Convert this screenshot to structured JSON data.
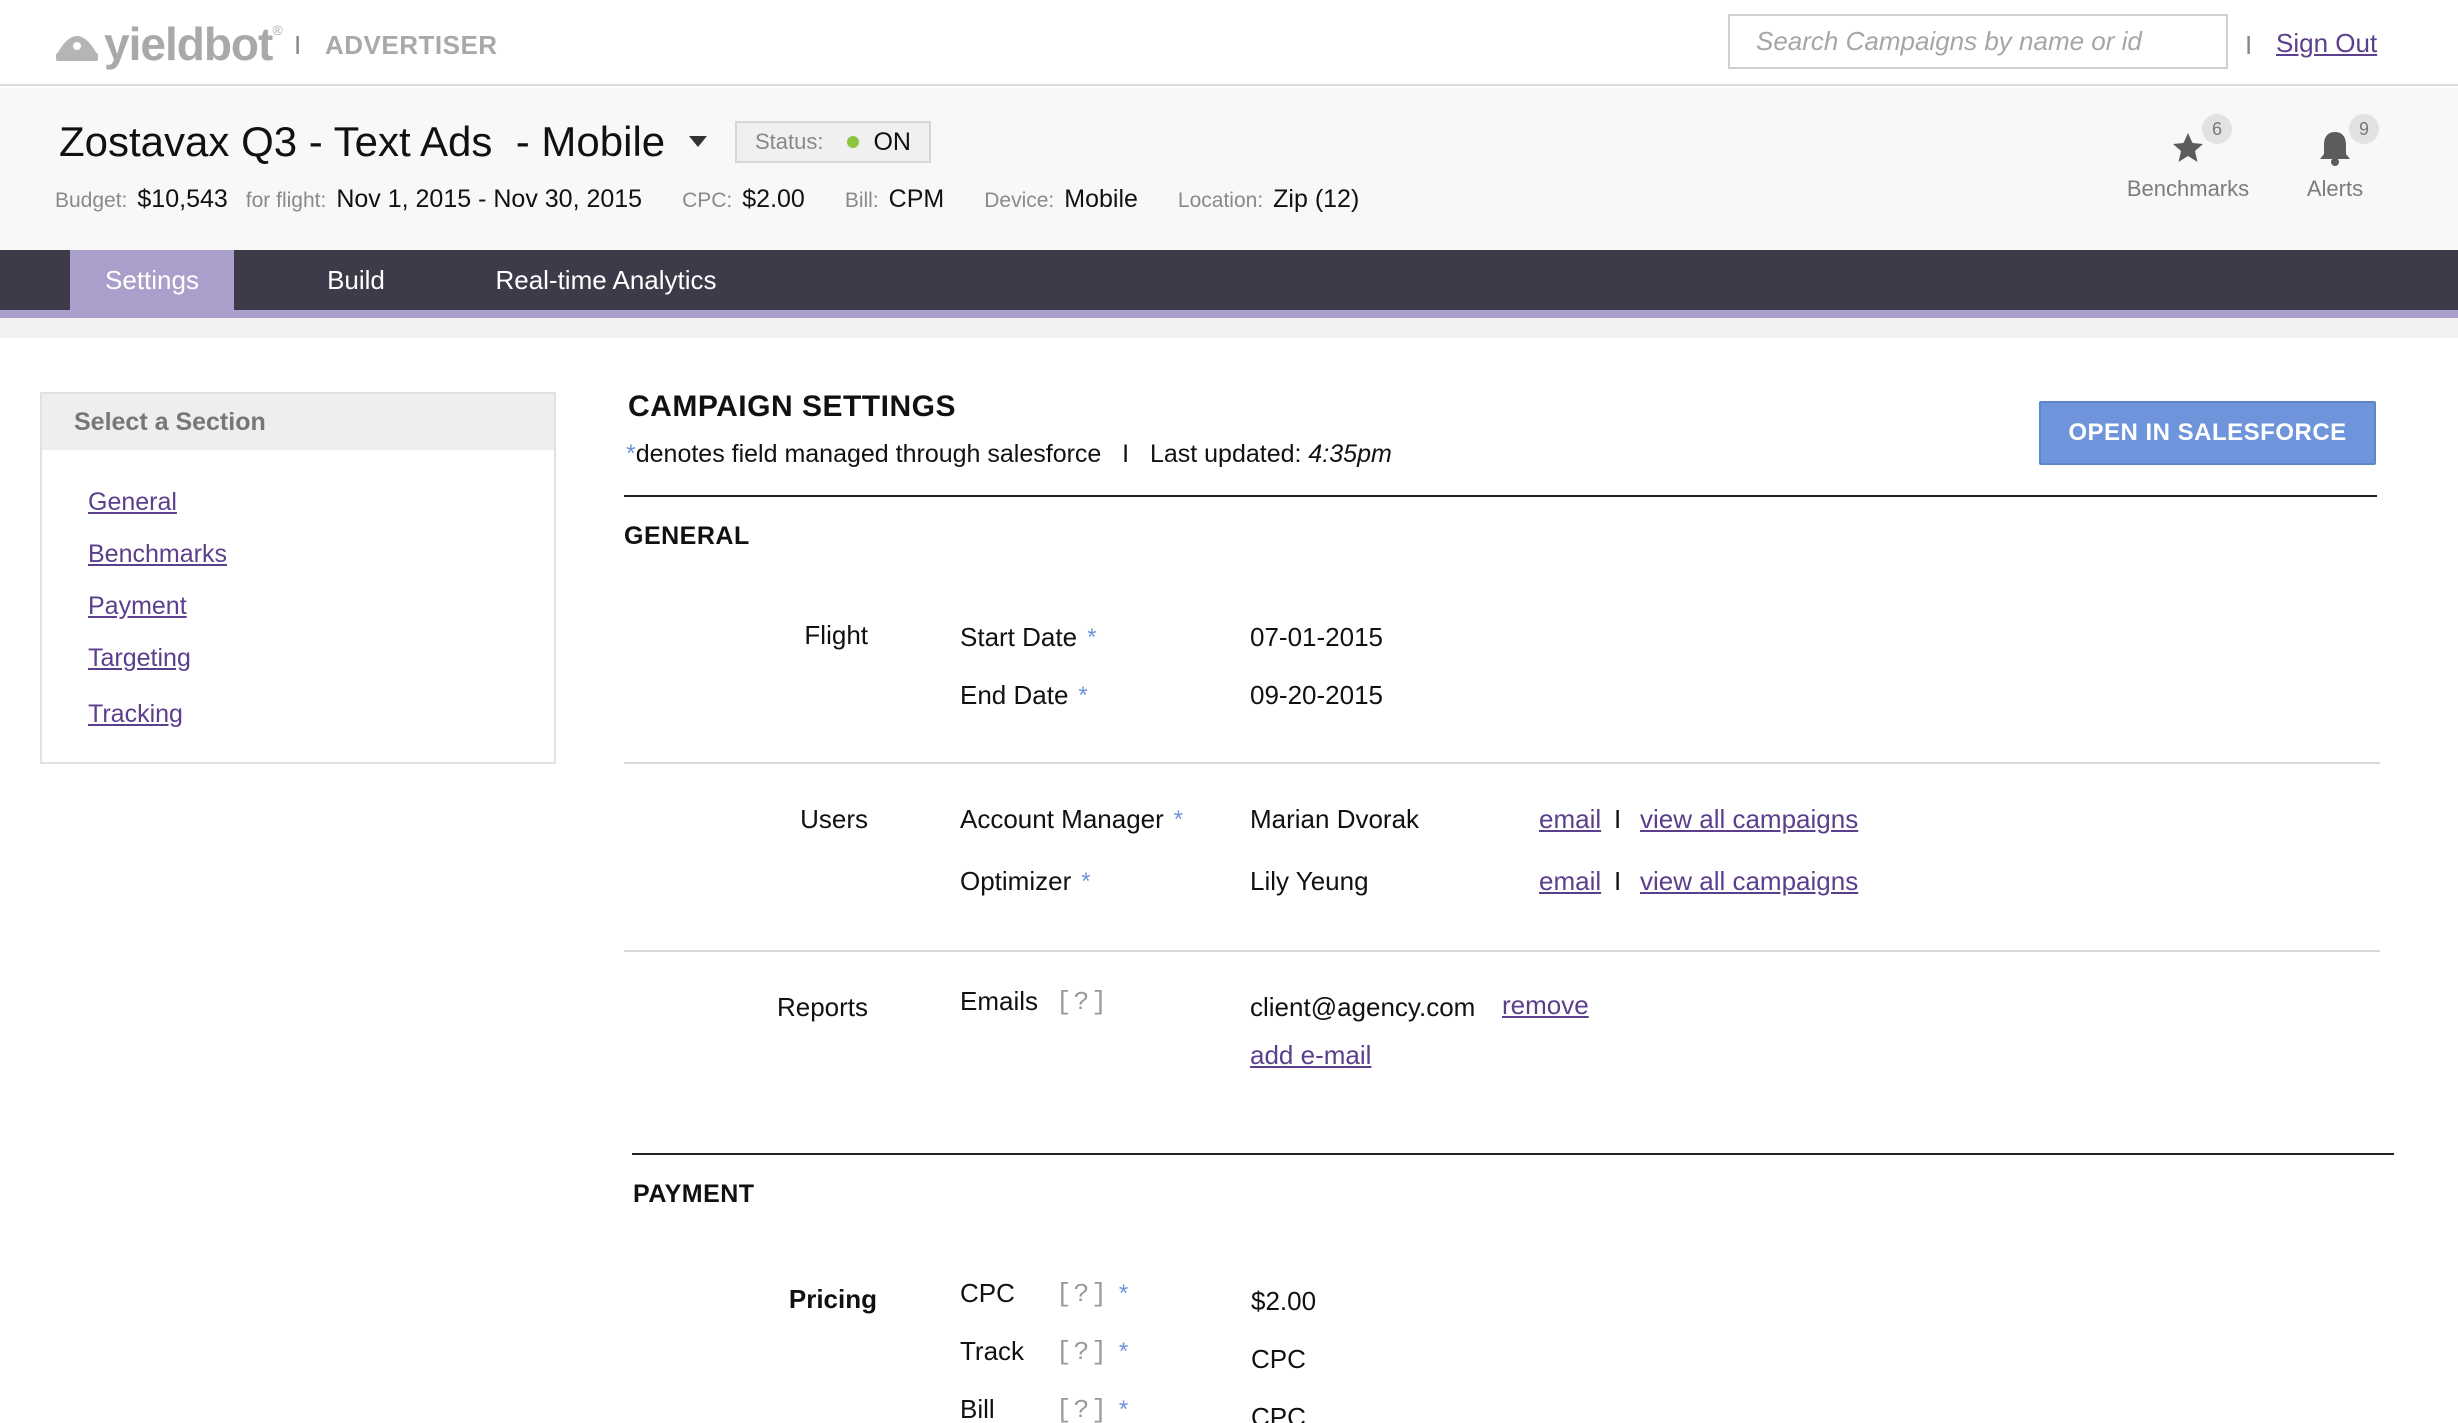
{
  "brand": {
    "logo_text": "yieldbot",
    "trademark": "®",
    "section": "ADVERTISER"
  },
  "top": {
    "search_placeholder": "Search Campaigns by name or id",
    "separator": "I",
    "signout": "Sign Out"
  },
  "campaign": {
    "title": "Zostavax Q3 - Text Ads  - Mobile",
    "status_label": "Status:",
    "status_value": "ON",
    "status_color": "#8cc63f",
    "meta": {
      "budget_label": "Budget:",
      "budget": "$10,543",
      "flight_label": "for flight:",
      "flight": "Nov 1, 2015 - Nov 30, 2015",
      "cpc_label": "CPC:",
      "cpc": "$2.00",
      "bill_label": "Bill:",
      "bill": "CPM",
      "device_label": "Device:",
      "device": "Mobile",
      "location_label": "Location:",
      "location": "Zip (12)"
    },
    "benchmarks": {
      "label": "Benchmarks",
      "count": "6",
      "icon": "star-icon"
    },
    "alerts": {
      "label": "Alerts",
      "count": "9",
      "icon": "bell-icon"
    }
  },
  "nav": {
    "tabs": [
      {
        "label": "Settings",
        "active": true
      },
      {
        "label": "Build"
      },
      {
        "label": "Real-time Analytics"
      }
    ]
  },
  "sidebar": {
    "title": "Select a Section",
    "items": [
      {
        "label": "General"
      },
      {
        "label": "Benchmarks"
      },
      {
        "label": "Payment"
      },
      {
        "label": "Targeting"
      },
      {
        "label": "Tracking"
      }
    ]
  },
  "settings": {
    "title": "CAMPAIGN SETTINGS",
    "legend_star": "*",
    "legend_text": "denotes field managed through salesforce   I   Last updated: ",
    "last_updated": "4:35pm",
    "salesforce_button": "OPEN IN SALESFORCE",
    "general": {
      "title": "GENERAL",
      "flight": {
        "group": "Flight",
        "start_label": "Start Date",
        "start": "07-01-2015",
        "end_label": "End Date",
        "end": "09-20-2015"
      },
      "users": {
        "group": "Users",
        "rows": [
          {
            "role": "Account Manager",
            "name": "Marian Dvorak",
            "email": "email",
            "view": "view all campaigns"
          },
          {
            "role": "Optimizer",
            "name": "Lily Yeung",
            "email": "email",
            "view": "view all campaigns"
          }
        ]
      },
      "reports": {
        "group": "Reports",
        "label": "Emails",
        "help": "[?]",
        "email": "client@agency.com",
        "remove": "remove",
        "add": "add e-mail"
      }
    },
    "payment": {
      "title": "PAYMENT",
      "group": "Pricing",
      "rows": [
        {
          "label": "CPC",
          "help": "[?]",
          "value": "$2.00"
        },
        {
          "label": "Track",
          "help": "[?]",
          "value": "CPC"
        },
        {
          "label": "Bill",
          "help": "[?]",
          "value": "CPC"
        }
      ]
    },
    "star": "*",
    "separator": "I"
  }
}
